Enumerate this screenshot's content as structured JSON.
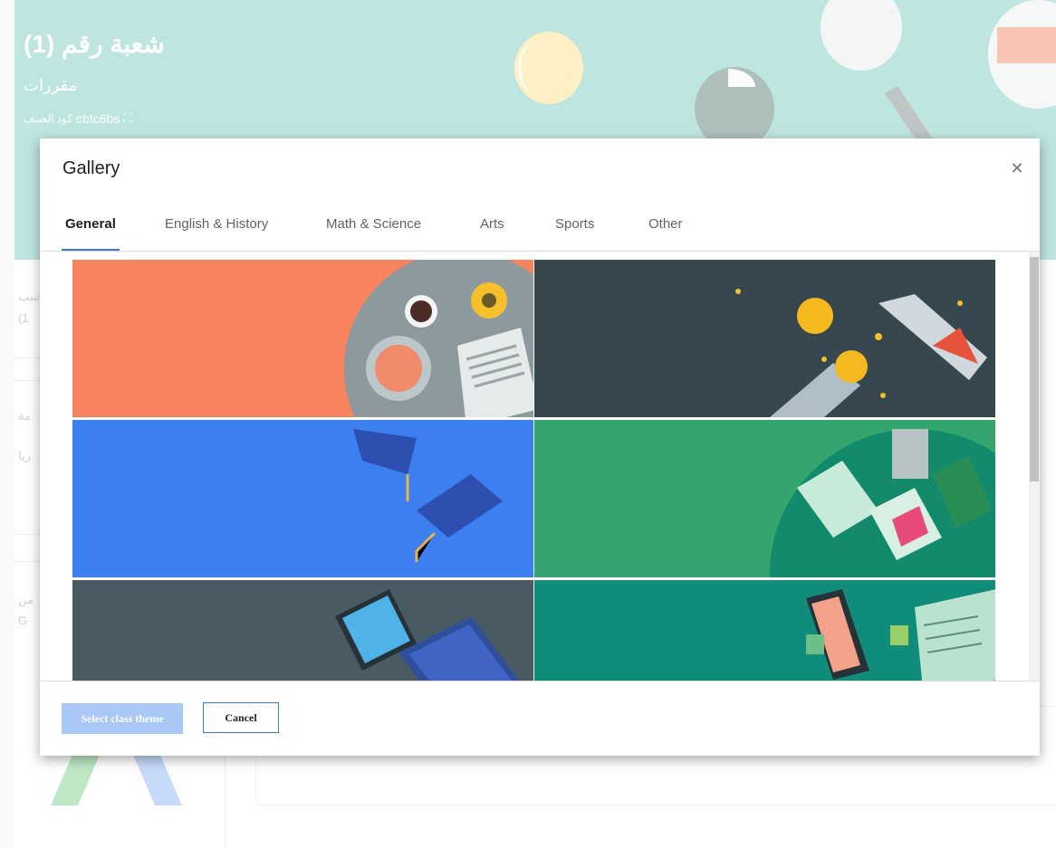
{
  "banner": {
    "title": "شعبة رقم (1)",
    "subtitle": "مقررات",
    "class_code_label": "كود الصنف",
    "class_code": "cbtc6bs",
    "color": "#7ecbc1"
  },
  "background_fragments": [
    "سب",
    "(1",
    "مة",
    "ريا",
    "من",
    "G"
  ],
  "dialog": {
    "title": "Gallery",
    "close_icon": "close-icon",
    "tabs": [
      {
        "label": "General",
        "active": true
      },
      {
        "label": "English & History",
        "active": false
      },
      {
        "label": "Math & Science",
        "active": false
      },
      {
        "label": "Arts",
        "active": false
      },
      {
        "label": "Sports",
        "active": false
      },
      {
        "label": "Other",
        "active": false
      }
    ],
    "themes": [
      {
        "name": "coffee-and-newspaper-theme",
        "color": "#f7845e"
      },
      {
        "name": "diploma-and-medals-theme",
        "color": "#37474f"
      },
      {
        "name": "graduation-caps-theme",
        "color": "#3b7ff0"
      },
      {
        "name": "notebooks-theme",
        "color": "#34a56f"
      },
      {
        "name": "laptop-and-tablet-theme",
        "color": "#4a5a63"
      },
      {
        "name": "phone-and-notes-theme",
        "color": "#0f8c7a"
      }
    ],
    "primary_button": "Select class theme",
    "cancel_button": "Cancel",
    "accent": "#3c78d8"
  }
}
